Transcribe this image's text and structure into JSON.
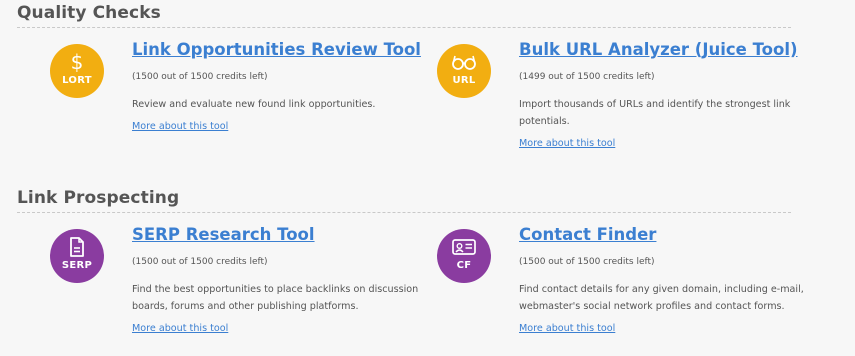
{
  "sections": [
    {
      "title": "Quality Checks",
      "tools": [
        {
          "icon": "dollar-icon",
          "abbr": "LORT",
          "title": "Link Opportunities Review Tool",
          "credits": "(1500 out of 1500 credits left)",
          "description": "Review and evaluate new found link opportunities.",
          "more": "More about this tool",
          "color": "#f2ae11"
        },
        {
          "icon": "glasses-icon",
          "abbr": "URL",
          "title": "Bulk URL Analyzer (Juice Tool)",
          "credits": "(1499 out of 1500 credits left)",
          "description": "Import thousands of URLs and identify the strongest link potentials.",
          "more": "More about this tool",
          "color": "#f2ae11"
        }
      ]
    },
    {
      "title": "Link Prospecting",
      "tools": [
        {
          "icon": "document-icon",
          "abbr": "SERP",
          "title": "SERP Research Tool",
          "credits": "(1500 out of 1500 credits left)",
          "description": "Find the best opportunities to place backlinks on discussion boards, forums and other publishing platforms.",
          "more": "More about this tool",
          "color": "#8a3ca0"
        },
        {
          "icon": "contact-card-icon",
          "abbr": "CF",
          "title": "Contact Finder",
          "credits": "(1500 out of 1500 credits left)",
          "description": "Find contact details for any given domain, including e-mail, webmaster's social network profiles and contact forms.",
          "more": "More about this tool",
          "color": "#8a3ca0"
        }
      ]
    }
  ]
}
